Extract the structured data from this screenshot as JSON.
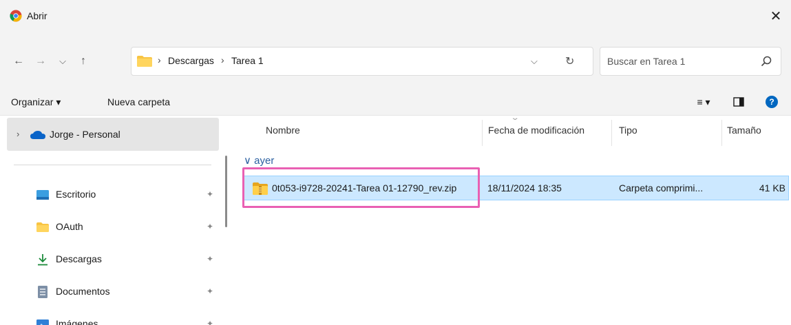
{
  "window": {
    "title": "Abrir",
    "close_glyph": "✕"
  },
  "nav": {
    "back": "←",
    "forward": "→",
    "recent": "⌵",
    "up": "↑",
    "breadcrumbs": [
      "Descargas",
      "Tarea 1"
    ],
    "separator": "›",
    "dropdown": "⌵",
    "refresh": "↻"
  },
  "search": {
    "placeholder": "Buscar en Tarea 1"
  },
  "toolbar": {
    "organize": "Organizar ▾",
    "new_folder": "Nueva carpeta",
    "view_menu": "≡ ▾",
    "help": "?"
  },
  "navpane": {
    "onedrive": {
      "label": "Jorge - Personal"
    },
    "quick_access": [
      {
        "label": "Escritorio",
        "icon": "desktop-icon"
      },
      {
        "label": "OAuth",
        "icon": "folder-icon"
      },
      {
        "label": "Descargas",
        "icon": "download-icon"
      },
      {
        "label": "Documentos",
        "icon": "documents-icon"
      },
      {
        "label": "Imágenes",
        "icon": "pictures-icon"
      }
    ],
    "pin_glyph": "📌"
  },
  "columns": {
    "name": "Nombre",
    "modified": "Fecha de modificación",
    "type": "Tipo",
    "size": "Tamaño"
  },
  "group": {
    "label": "∨ ayer"
  },
  "files": [
    {
      "name": "0t053-i9728-20241-Tarea 01-12790_rev.zip",
      "modified": "18/11/2024 18:35",
      "type": "Carpeta comprimi...",
      "size": "41 KB",
      "selected": true
    }
  ],
  "colors": {
    "highlight": "#e960b3",
    "selection": "#cce8ff",
    "accent": "#0067c0"
  }
}
